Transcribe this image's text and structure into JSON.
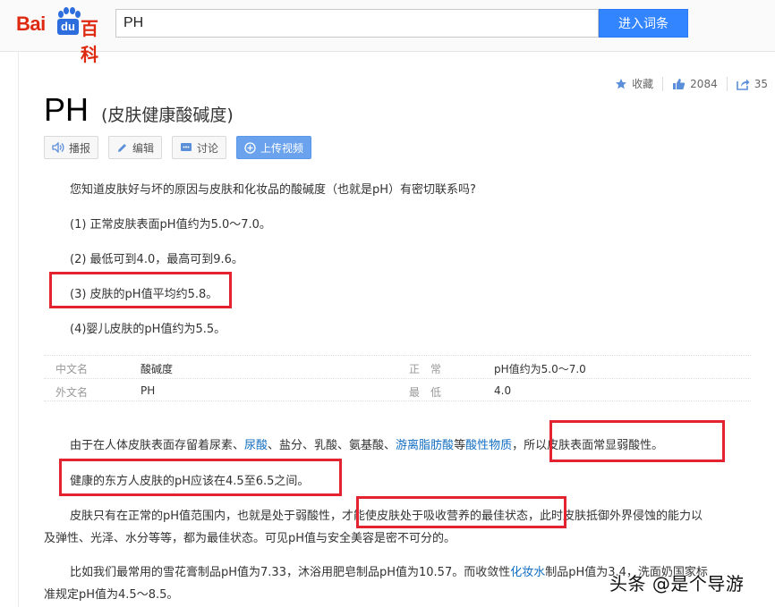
{
  "header": {
    "logo_left": "Bai",
    "logo_du": "du",
    "logo_right": "百科",
    "search_value": "PH",
    "search_button": "进入词条"
  },
  "actions": {
    "favorite": "收藏",
    "likes": "2084",
    "shares": "35"
  },
  "entry": {
    "title": "PH",
    "subtitle": "(皮肤健康酸碱度)"
  },
  "toolbar": {
    "play": "播报",
    "edit": "编辑",
    "discuss": "讨论",
    "upload_video": "上传视频"
  },
  "paragraphs": {
    "intro": "您知道皮肤好与坏的原因与皮肤和化妆品的酸碱度（也就是pH）有密切联系吗?",
    "p1": "(1) 正常皮肤表面pH值约为5.0～7.0。",
    "p2": "(2) 最低可到4.0，最高可到9.6。",
    "p3": "(3) 皮肤的pH值平均约5.8。",
    "p4": "(4)婴儿皮肤的pH值约为5.5。"
  },
  "basic_info": {
    "row1": {
      "k1": "中文名",
      "v1": "酸碱度",
      "k2": "正　常",
      "v2": "pH值约为5.0～7.0"
    },
    "row2": {
      "k1": "外文名",
      "v1": "PH",
      "k2": "最　低",
      "v2": "4.0"
    }
  },
  "body": {
    "s1_a": "由于在人体皮肤表面存留着尿素、",
    "s1_link1": "尿酸",
    "s1_b": "、盐分、乳酸、氨基酸、",
    "s1_link2": "游离脂肪酸",
    "s1_c": "等",
    "s1_link3": "酸性物质",
    "s1_d": "，所以皮肤表面常显弱酸性。",
    "s2": "健康的东方人皮肤的pH应该在4.5至6.5之间。",
    "s3_a": "皮肤只有在正常的pH值范围内，也就是处于弱酸性，",
    "s3_b": "才能使皮肤处于吸收营养的最佳状态",
    "s3_c": "，此时皮肤抵御外界侵蚀的能力以",
    "s3_line2": "及弹性、光泽、水分等等，都为最佳状态。可见pH值与安全美容是密不可分的。",
    "s4_a": "比如我们最常用的雪花膏制品pH值为7.33，沐浴用肥皂制品pH值为10.57。而收敛性",
    "s4_link": "化妆水",
    "s4_b": "制品pH值为3.4，洗面奶国家标",
    "s4_line2": "准规定pH值为4.5～8.5。"
  },
  "watermark": "头条 @是个导游",
  "colors": {
    "highlight_box": "#e3232f",
    "link": "#136ec2",
    "search_button": "#3385ff",
    "logo_red": "#de2910"
  }
}
